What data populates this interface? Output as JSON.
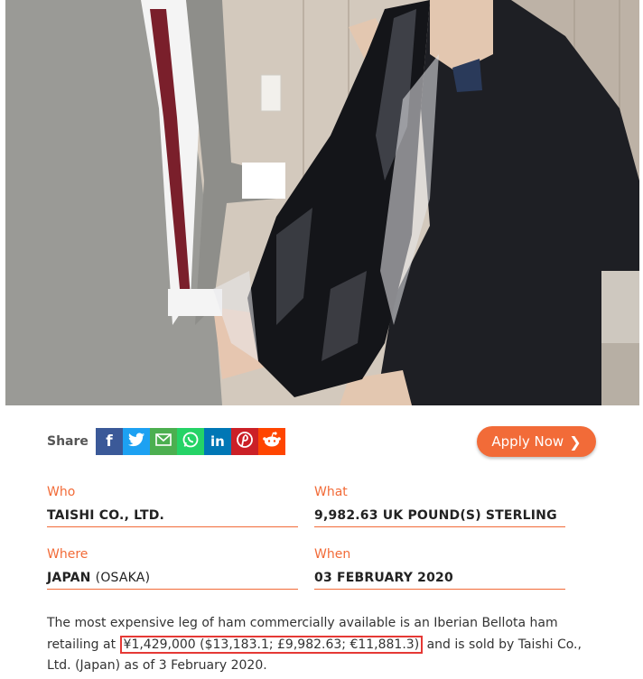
{
  "share": {
    "label": "Share",
    "buttons": [
      {
        "name": "facebook-icon",
        "glyph": "f",
        "color": "#3b5998"
      },
      {
        "name": "twitter-icon",
        "glyph": "t",
        "color": "#1da1f2"
      },
      {
        "name": "email-icon",
        "glyph": "✉",
        "color": "#4caf50"
      },
      {
        "name": "whatsapp-icon",
        "glyph": "w",
        "color": "#25d366"
      },
      {
        "name": "linkedin-icon",
        "glyph": "in",
        "color": "#0077b5"
      },
      {
        "name": "pinterest-icon",
        "glyph": "p",
        "color": "#cb2027"
      },
      {
        "name": "reddit-icon",
        "glyph": "r",
        "color": "#ff4500"
      }
    ]
  },
  "apply_button": {
    "label": "Apply Now",
    "color": "#f26b38"
  },
  "details": {
    "who": {
      "label": "Who",
      "value": "TAISHI CO., LTD."
    },
    "what": {
      "label": "What",
      "value": "9,982.63 UK POUND(S) STERLING"
    },
    "where": {
      "label": "Where",
      "value": "JAPAN",
      "value_detail": "(OSAKA)"
    },
    "when": {
      "label": "When",
      "value": "03 FEBRUARY 2020"
    }
  },
  "description": {
    "before": "The most expensive leg of ham commercially available is an Iberian Bellota ham retailing at ",
    "highlight": "¥1,429,000 ($13,183.1; £9,982.63; €11,881.3)",
    "after": " and is sold by Taishi Co., Ltd. (Japan) as of 3 February 2020."
  },
  "accent_color": "#f26b38",
  "highlight_color": "#e53935"
}
